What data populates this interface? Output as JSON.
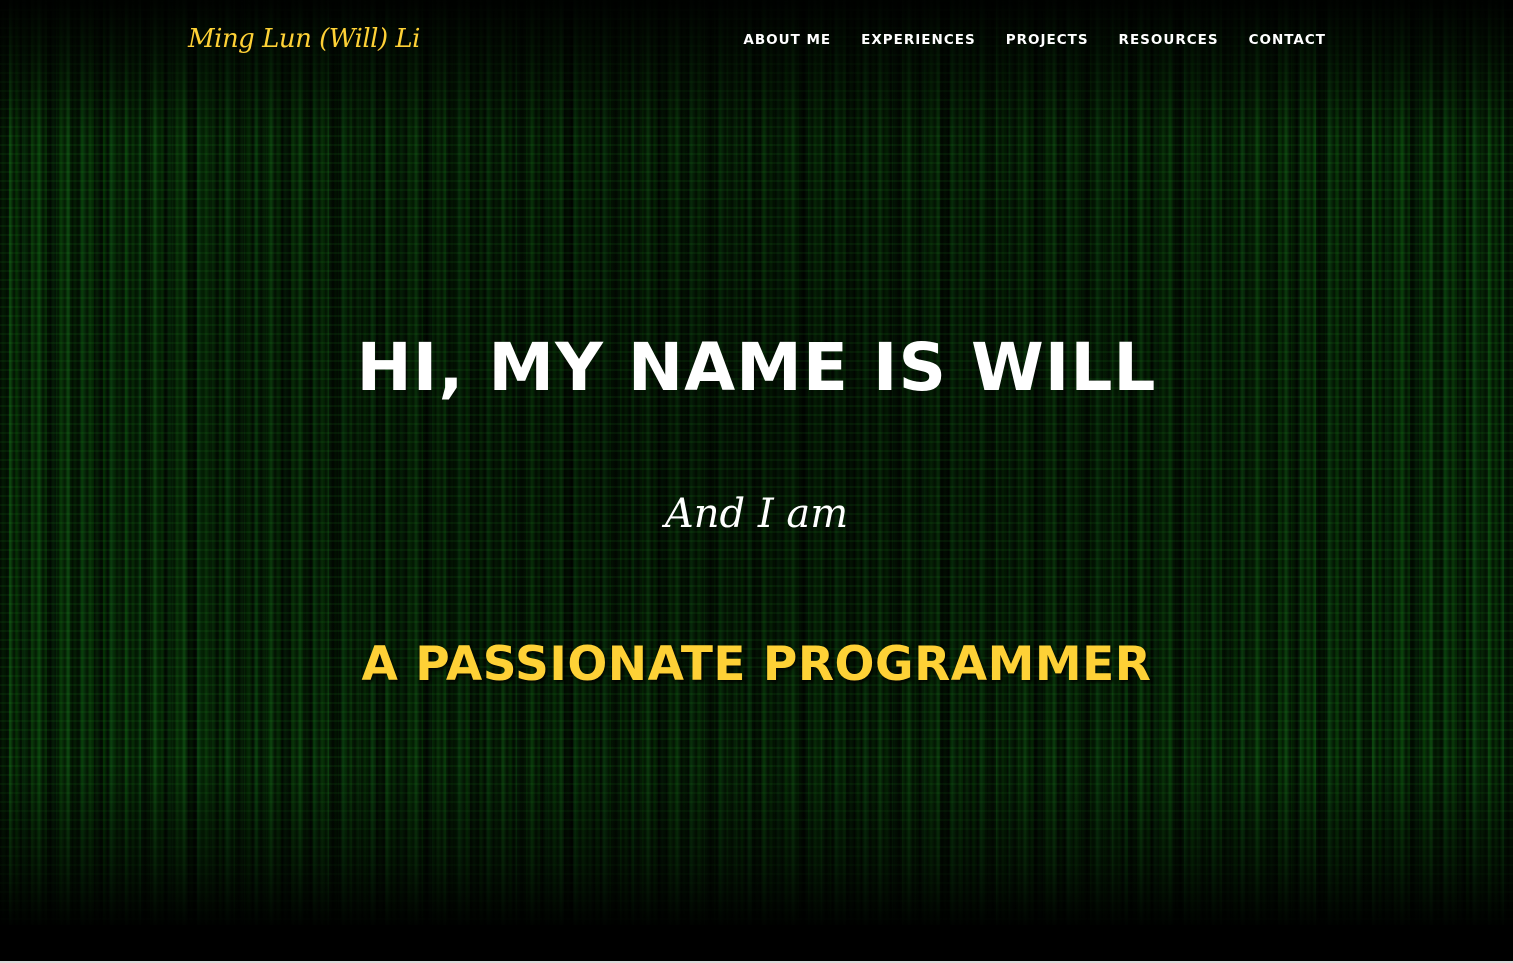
{
  "navbar": {
    "brand": "Ming Lun (Will) Li",
    "links": [
      {
        "label": "ABOUT ME"
      },
      {
        "label": "EXPERIENCES"
      },
      {
        "label": "PROJECTS"
      },
      {
        "label": "RESOURCES"
      },
      {
        "label": "CONTACT"
      }
    ]
  },
  "hero": {
    "title": "HI, MY NAME IS WILL",
    "subtitle": "And I am",
    "role": "A PASSIONATE PROGRAMMER"
  },
  "colors": {
    "accent": "#fed136",
    "text": "#ffffff",
    "background": "#000000",
    "matrix_green": "#0e4a10"
  }
}
